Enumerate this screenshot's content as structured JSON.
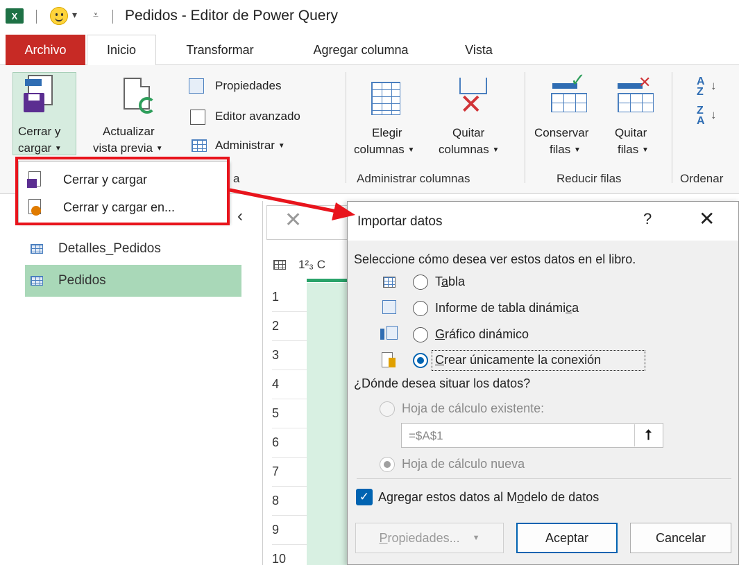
{
  "titlebar": {
    "app_badge": "X",
    "quick_access_glyph": "▾",
    "customize_glyph": "⩡",
    "title": "Pedidos - Editor de Power Query"
  },
  "ribbon_tabs": [
    {
      "label": "Archivo"
    },
    {
      "label": "Inicio"
    },
    {
      "label": "Transformar"
    },
    {
      "label": "Agregar columna"
    },
    {
      "label": "Vista"
    }
  ],
  "ribbon": {
    "close_load": {
      "line1": "Cerrar y",
      "line2": "cargar"
    },
    "refresh": {
      "line1": "Actualizar",
      "line2": "vista previa"
    },
    "properties": "Propiedades",
    "advanced_editor": "Editor avanzado",
    "manage": "Administrar",
    "query_group_tail": "a",
    "choose_columns": {
      "line1": "Elegir",
      "line2": "columnas"
    },
    "remove_columns": {
      "line1": "Quitar",
      "line2": "columnas"
    },
    "manage_columns_group": "Administrar columnas",
    "keep_rows": {
      "line1": "Conservar",
      "line2": "filas"
    },
    "remove_rows": {
      "line1": "Quitar",
      "line2": "filas"
    },
    "reduce_rows_group": "Reducir filas",
    "sort_group": "Ordenar",
    "sort_asc": "A\nZ",
    "sort_desc": "Z\nA"
  },
  "close_load_menu": [
    {
      "label": "Cerrar y cargar"
    },
    {
      "label": "Cerrar y cargar en..."
    }
  ],
  "queries": [
    {
      "label": "Detalles_Pedidos",
      "selected": false
    },
    {
      "label": "Pedidos",
      "selected": true
    }
  ],
  "grid": {
    "column_header": "1²₃ C",
    "rows": [
      "1",
      "2",
      "3",
      "4",
      "5",
      "6",
      "7",
      "8",
      "9",
      "10"
    ]
  },
  "dialog": {
    "title": "Importar datos",
    "help": "?",
    "close": "✕",
    "view_prompt": "Seleccione cómo desea ver estos datos en el libro.",
    "view_options": [
      {
        "label_pre": "T",
        "label_u": "a",
        "label_post": "bla",
        "checked": false
      },
      {
        "label_pre": "Informe de tabla dinámi",
        "label_u": "c",
        "label_post": "a",
        "checked": false
      },
      {
        "label_pre": "",
        "label_u": "G",
        "label_post": "ráfico dinámico",
        "checked": false
      },
      {
        "label_pre": "",
        "label_u": "C",
        "label_post": "rear únicamente la conexión",
        "checked": true
      }
    ],
    "location_prompt": "¿Dónde desea situar los datos?",
    "existing_sheet": "Hoja de cálculo existente:",
    "cell_ref": "=$A$1",
    "upload_glyph": "⭡",
    "new_sheet": "Hoja de cálculo nueva",
    "add_to_model_pre": "Agregar estos datos al M",
    "add_to_model_u": "o",
    "add_to_model_post": "delo de datos",
    "add_to_model_checked": true,
    "properties_pre": "",
    "properties_u": "P",
    "properties_post": "ropiedades...",
    "accept": "Aceptar",
    "cancel": "Cancelar"
  },
  "colors": {
    "excel_green": "#1e7145",
    "file_tab_red": "#c72a25",
    "highlight_red": "#e8141c",
    "selection_green": "#a9d8b8",
    "accent_blue": "#0063b1"
  }
}
